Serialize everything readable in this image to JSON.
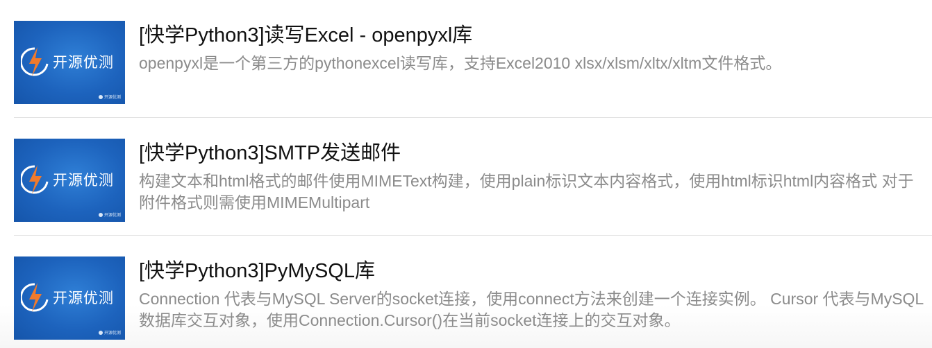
{
  "brand": {
    "name": "开源优测",
    "watermark": "开源优测"
  },
  "colors": {
    "thumb_blue": "#1d63bd",
    "logo_orange": "#f07a2c",
    "title_text": "#111111",
    "desc_text": "#8b8b8b"
  },
  "articles": [
    {
      "title": "[快学Python3]读写Excel - openpyxl库",
      "description": "openpyxl是一个第三方的pythonexcel读写库，支持Excel2010 xlsx/xlsm/xltx/xltm文件格式。"
    },
    {
      "title": "[快学Python3]SMTP发送邮件",
      "description": "构建文本和html格式的邮件使用MIMEText构建，使用plain标识文本内容格式，使用html标识html内容格式 对于附件格式则需使用MIMEMultipart"
    },
    {
      "title": "[快学Python3]PyMySQL库",
      "description": "Connection 代表与MySQL Server的socket连接，使用connect方法来创建一个连接实例。 Cursor 代表与MySQL数据库交互对象，使用Connection.Cursor()在当前socket连接上的交互对象。"
    }
  ]
}
